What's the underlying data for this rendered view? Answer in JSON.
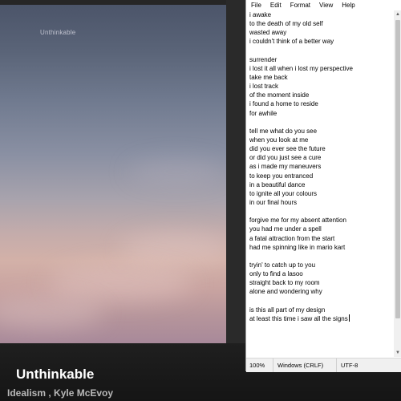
{
  "cover": {
    "title": "Unthinkable"
  },
  "player": {
    "title": "Unthinkable",
    "artists": "Idealism , Kyle McEvoy"
  },
  "notepad": {
    "menu": [
      "File",
      "Edit",
      "Format",
      "View",
      "Help"
    ],
    "lines": [
      "i awake",
      "to the death of my old self",
      "wasted away",
      "i couldn't think of a better way",
      "",
      "surrender",
      "i lost it all when i lost my perspective",
      "take me back",
      "i lost track",
      "of the moment inside",
      "i found a home to reside",
      "for awhile",
      "",
      "tell me what do you see",
      "when you look at me",
      "did you ever see the future",
      "or did you just see a cure",
      "as i made my maneuvers",
      "to keep you entranced",
      "in a beautiful dance",
      "to ignite all your colours",
      "in our final hours",
      "",
      "forgive me for my absent attention",
      "you had me under a spell",
      "a fatal attraction from the start",
      "had me spinning like in mario kart",
      "",
      "tryin' to catch up to you",
      "only to find a lasoo",
      "straight back to my room",
      "alone and wondering why",
      "",
      "is this all part of my design",
      "at least this time i saw all the signs"
    ],
    "status": {
      "zoom": "100%",
      "line_endings": "Windows (CRLF)",
      "encoding": "UTF-8"
    }
  }
}
